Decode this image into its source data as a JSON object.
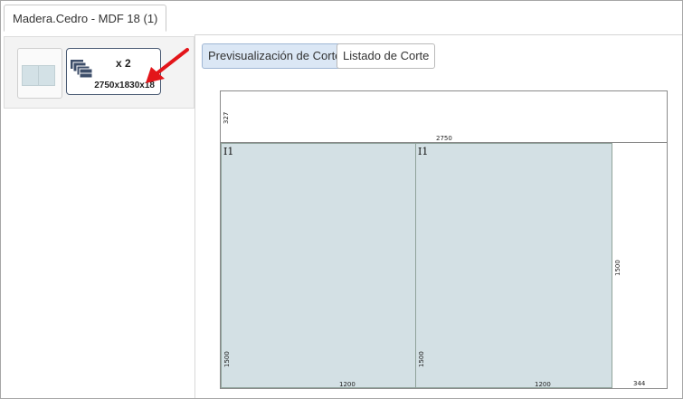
{
  "window": {
    "tab_title": "Madera.Cedro - MDF 18 (1)"
  },
  "sheets": {
    "selected": {
      "quantity_label": "x 2",
      "dimensions": "2750x1830x18"
    }
  },
  "toolbar": {
    "preview_label": "Previsualización de Corte",
    "list_label": "Listado de Corte"
  },
  "layout": {
    "top_strip_height_label": "327",
    "sheet_width_label": "2750",
    "pieces": [
      {
        "label": "I1",
        "width_label": "1200",
        "height_label": "1500"
      },
      {
        "label": "I1",
        "width_label": "1200",
        "height_label": "1500"
      }
    ],
    "remainder_height_label": "1500",
    "remainder_width_label": "344"
  },
  "colors": {
    "piece_fill": "#d3e0e4",
    "accent": "#dbe7f5",
    "arrow": "#e3151a"
  }
}
